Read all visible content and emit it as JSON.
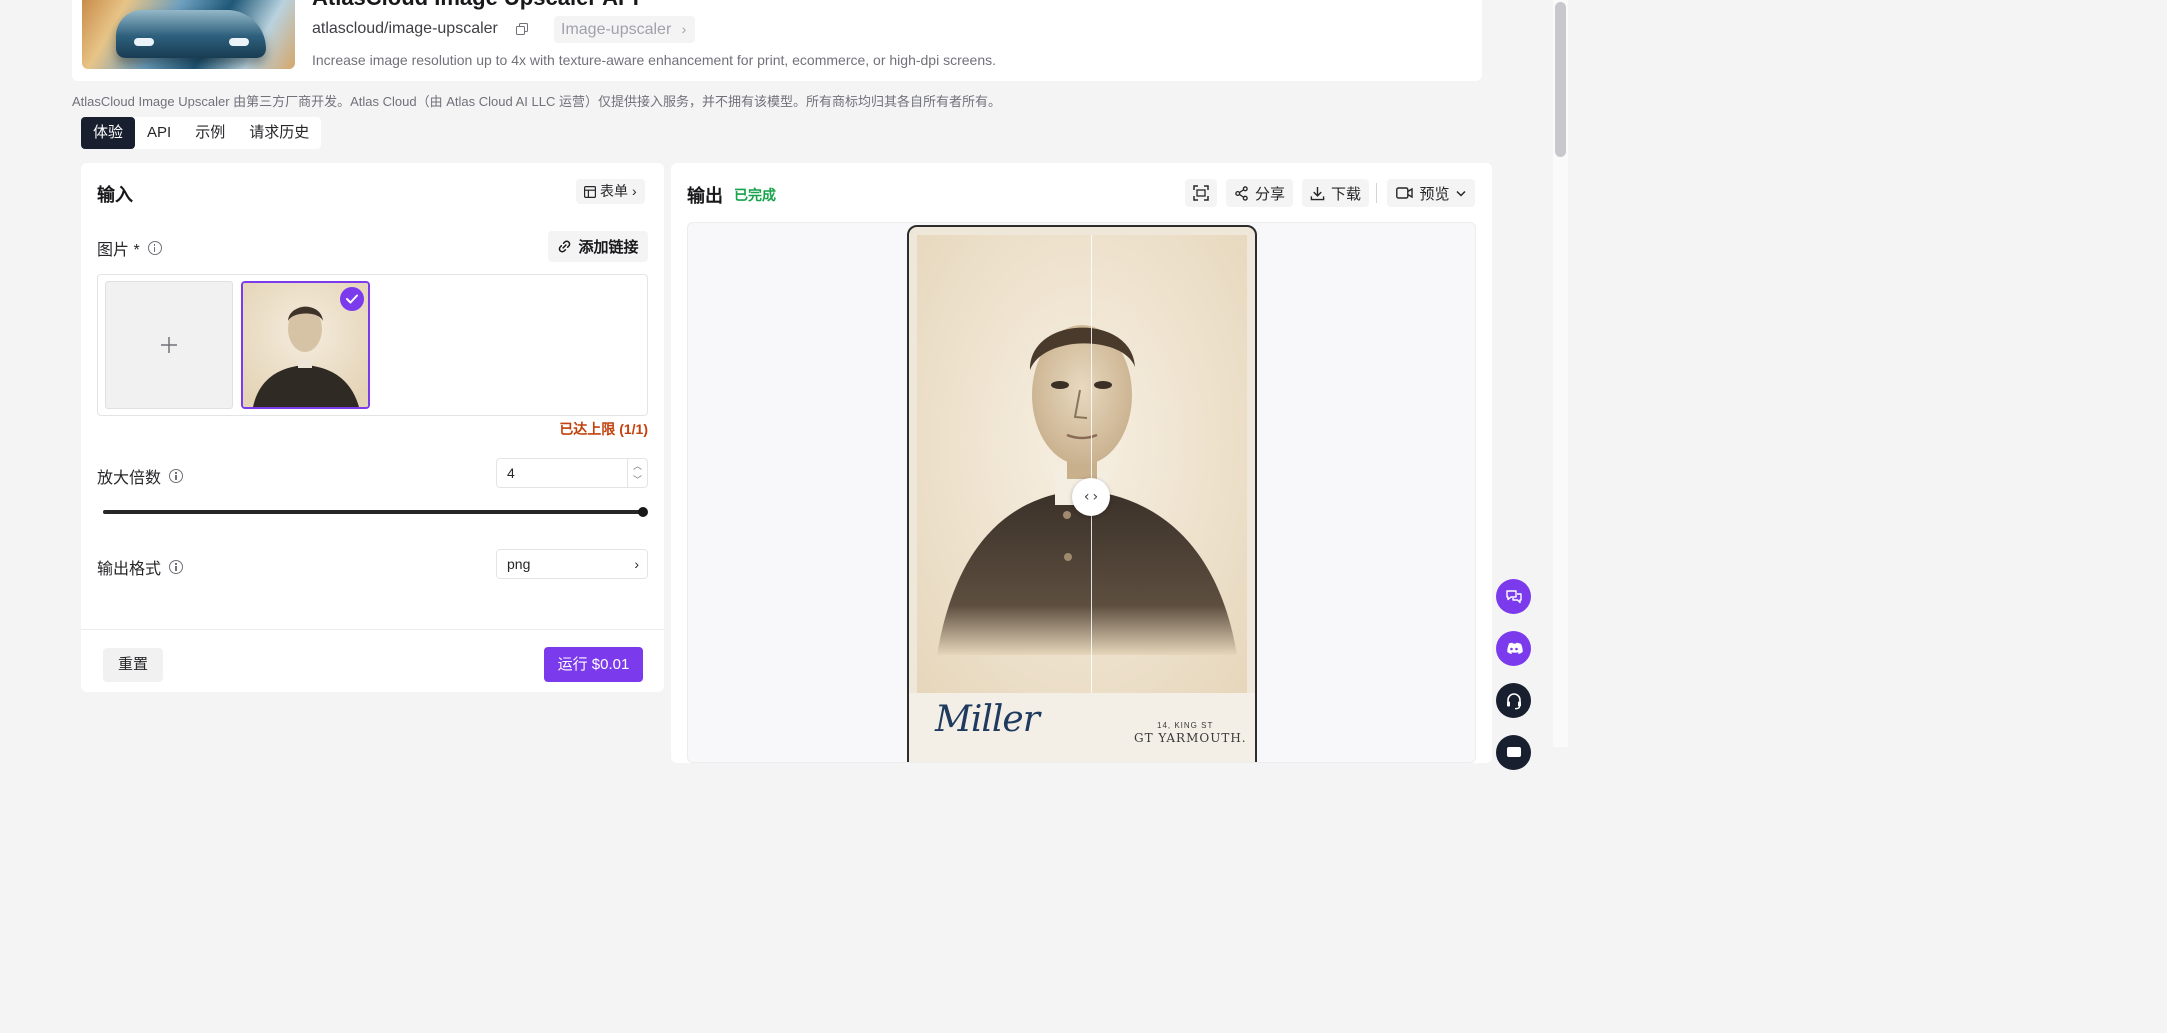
{
  "header": {
    "model_title": "AtlasCloud Image Upscaler API",
    "model_id": "atlascloud/image-upscaler",
    "tag_label": "Image-upscaler",
    "description": "Increase image resolution up to 4x with texture-aware enhancement for print, ecommerce, or high-dpi screens."
  },
  "disclaimer": "AtlasCloud Image Upscaler 由第三方厂商开发。Atlas Cloud（由 Atlas Cloud AI LLC 运营）仅提供接入服务，并不拥有该模型。所有商标均归其各自所有者所有。",
  "tabs": [
    {
      "label": "体验",
      "active": true
    },
    {
      "label": "API",
      "active": false
    },
    {
      "label": "示例",
      "active": false
    },
    {
      "label": "请求历史",
      "active": false
    }
  ],
  "input_panel": {
    "title": "输入",
    "form_toggle_label": "表单",
    "image_field": {
      "label": "图片 *",
      "add_link_label": "添加链接",
      "limit_text": "已达上限 (1/1)"
    },
    "scale_field": {
      "label": "放大倍数",
      "value": "4",
      "slider_fraction": 1.0
    },
    "format_field": {
      "label": "输出格式",
      "value": "png"
    },
    "reset_label": "重置",
    "run_label": "运行 $0.01"
  },
  "output_panel": {
    "title": "输出",
    "status": "已完成",
    "share_label": "分享",
    "download_label": "下载",
    "preview_label": "预览",
    "photo_studio": "Miller",
    "photo_address_line1": "14, KING ST",
    "photo_address_line2": "GT YARMOUTH."
  },
  "colors": {
    "accent": "#7c3aed",
    "success": "#16a34a",
    "warning": "#c2410c",
    "tab_active_bg": "#18202f"
  }
}
